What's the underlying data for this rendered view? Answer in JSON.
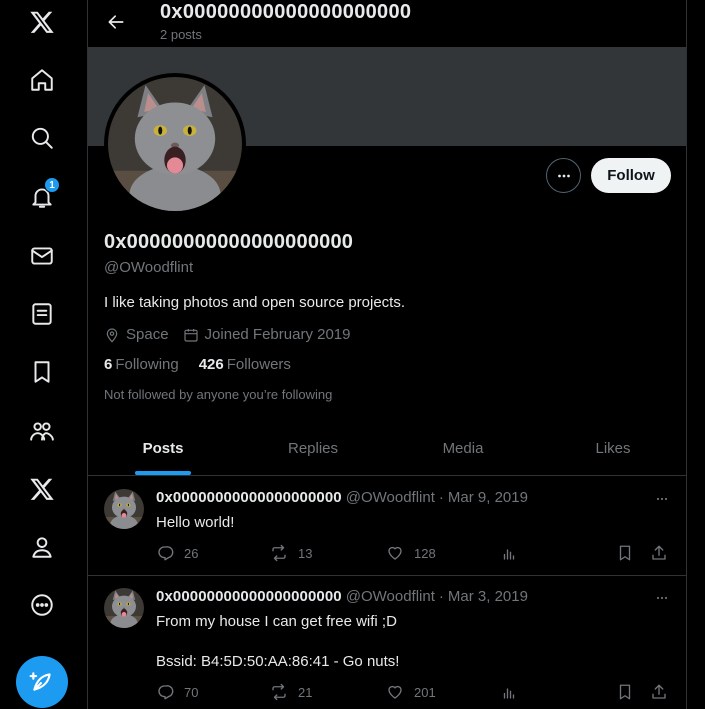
{
  "nav": {
    "notification_badge": "1",
    "items": [
      "x-logo",
      "home",
      "explore",
      "notifications",
      "messages",
      "lists",
      "bookmarks",
      "communities",
      "premium",
      "profile",
      "more"
    ]
  },
  "header": {
    "title": "0x00000000000000000000",
    "post_count": "2 posts"
  },
  "profile": {
    "name": "0x00000000000000000000",
    "handle": "@OWoodflint",
    "bio": "I like taking photos and open source projects.",
    "location": "Space",
    "joined": "Joined February 2019",
    "following_count": "6",
    "following_label": "Following",
    "followers_count": "426",
    "followers_label": "Followers",
    "not_followed": "Not followed by anyone you’re following",
    "follow_label": "Follow"
  },
  "tabs": [
    {
      "label": "Posts"
    },
    {
      "label": "Replies"
    },
    {
      "label": "Media"
    },
    {
      "label": "Likes"
    }
  ],
  "tweets": [
    {
      "name": "0x00000000000000000000",
      "handle": "@OWoodflint",
      "date": "Mar 9, 2019",
      "text": "Hello world!",
      "replies": "26",
      "reposts": "13",
      "likes": "128"
    },
    {
      "name": "0x00000000000000000000",
      "handle": "@OWoodflint",
      "date": "Mar 3, 2019",
      "text": "From my house I can get free wifi ;D\n\nBssid: B4:5D:50:AA:86:41 - Go nuts!",
      "replies": "70",
      "reposts": "21",
      "likes": "201"
    }
  ],
  "colors": {
    "accent": "#1d9bf0",
    "background": "#000000",
    "banner": "#333639",
    "muted_text": "#71767b",
    "text": "#e7e9ea"
  }
}
